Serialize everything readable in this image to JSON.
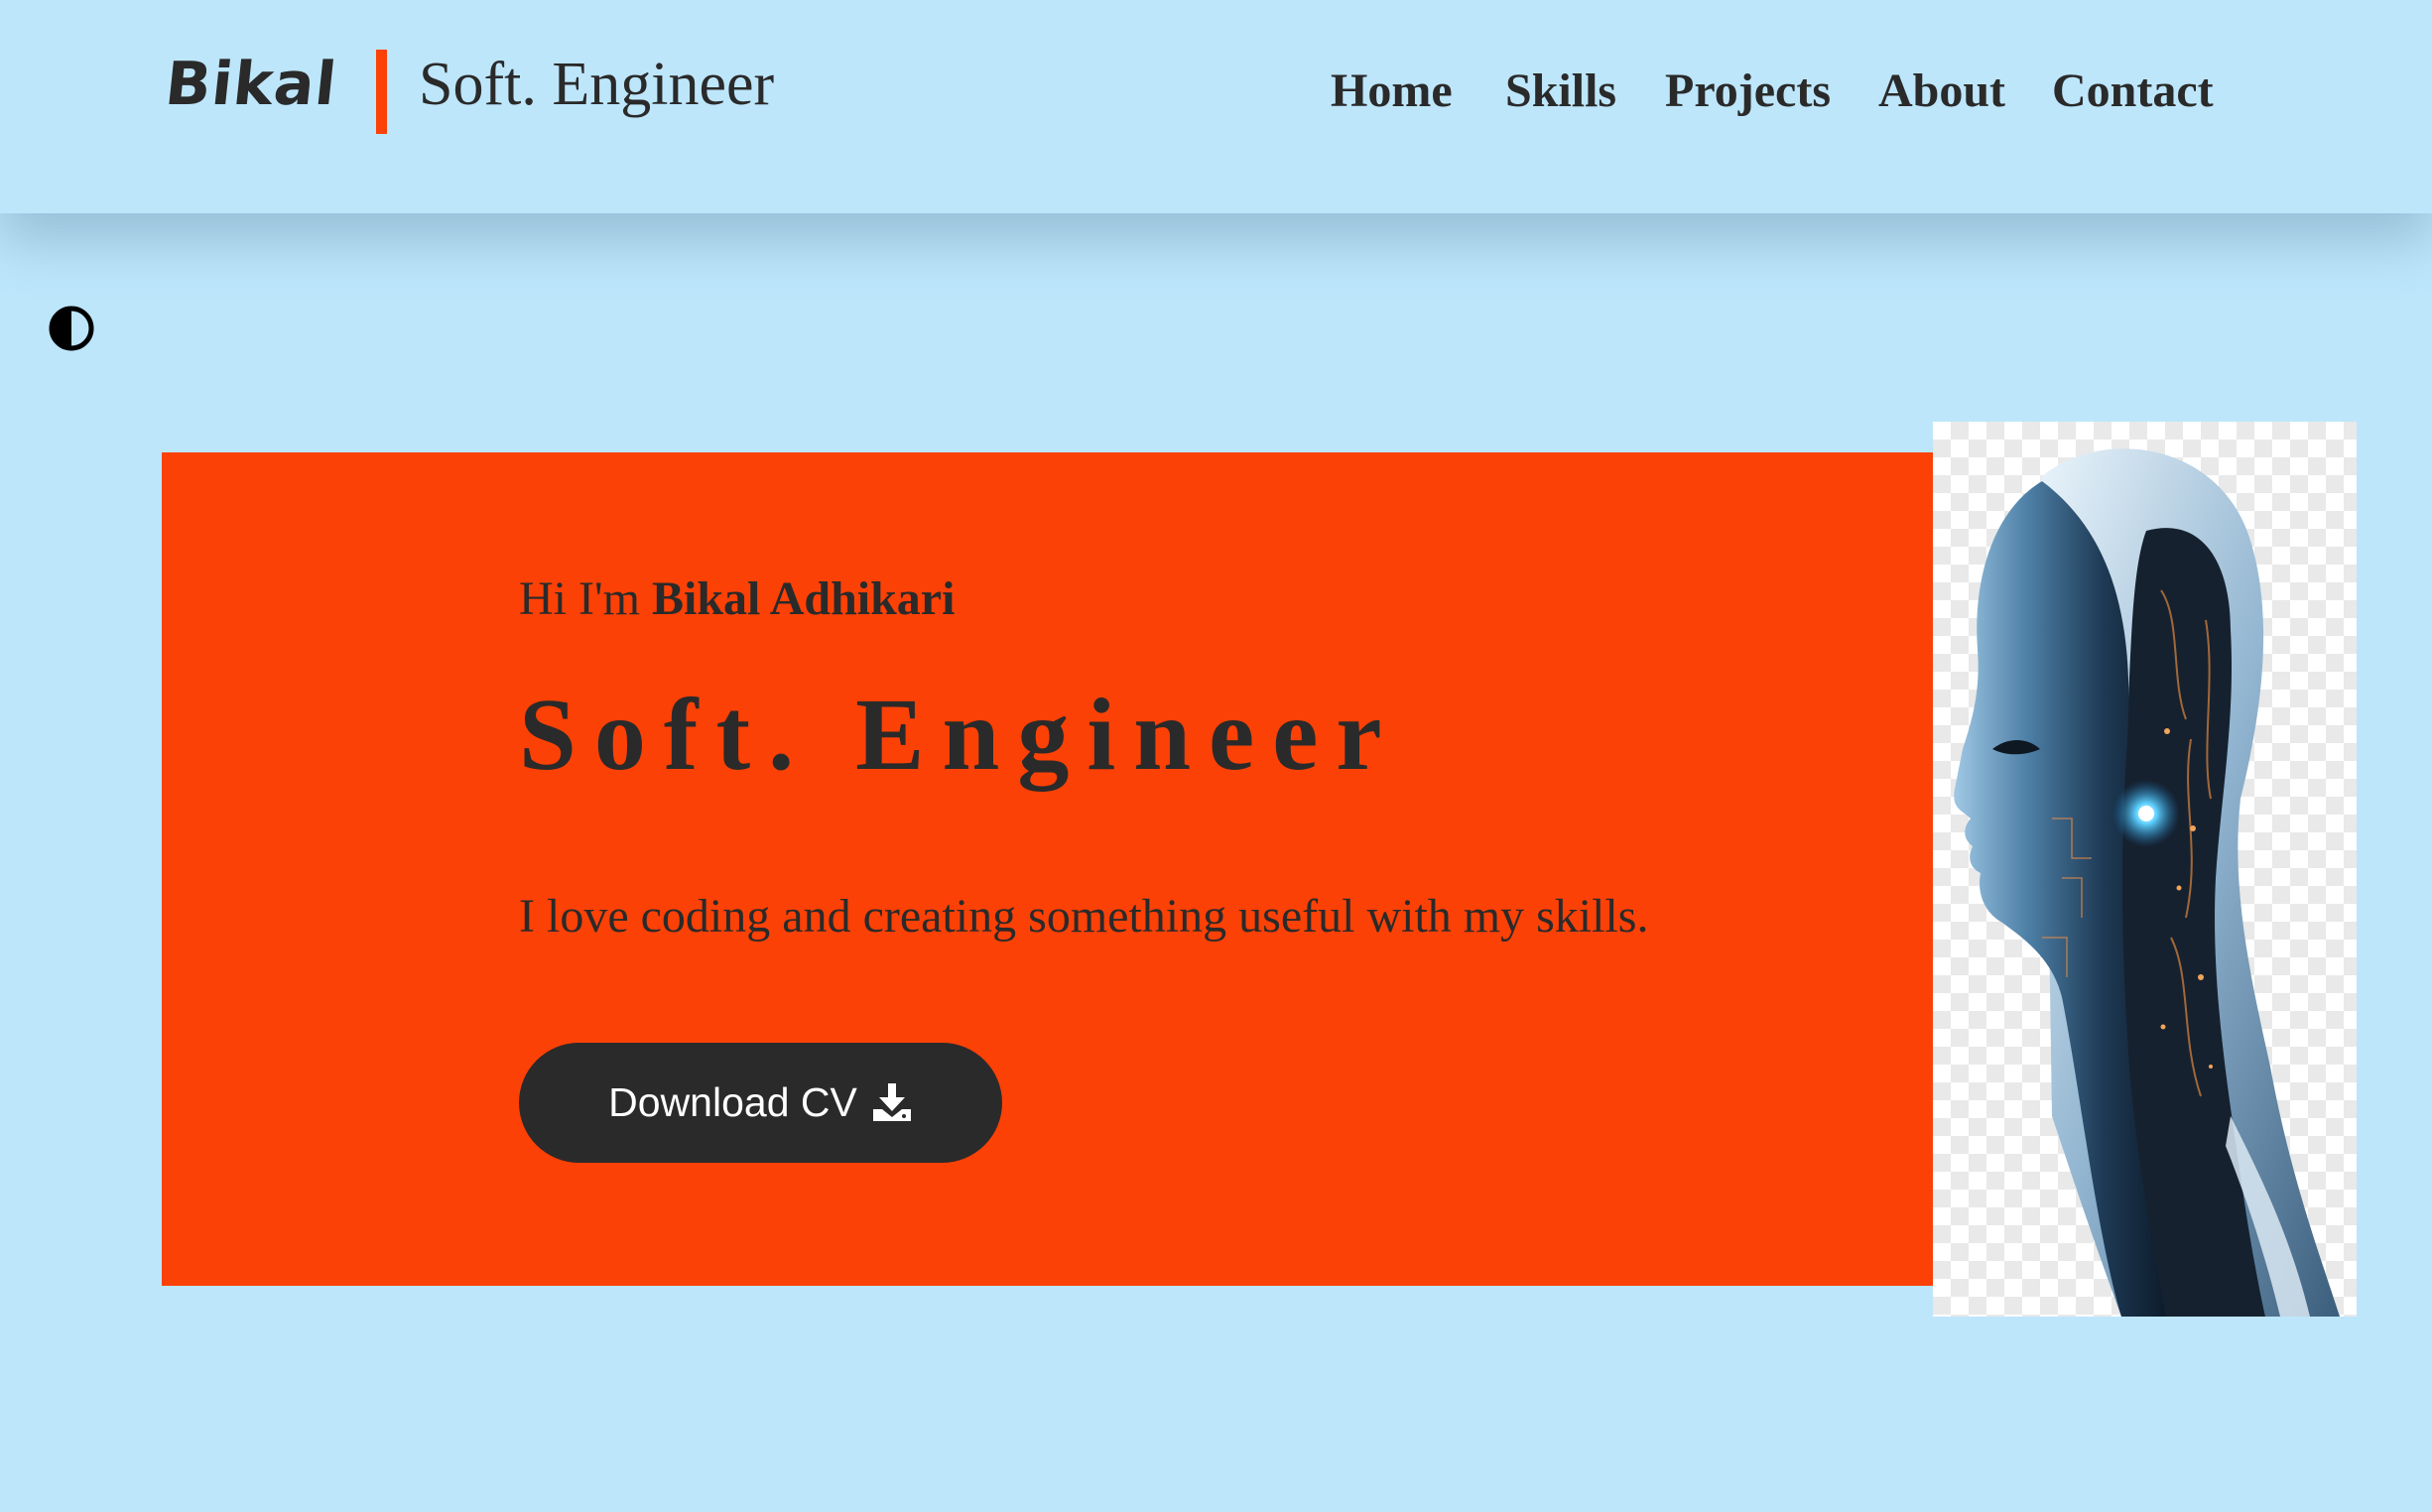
{
  "header": {
    "logo": "Bikal",
    "subtitle": "Soft. Engineer",
    "nav": [
      {
        "label": "Home"
      },
      {
        "label": "Skills"
      },
      {
        "label": "Projects"
      },
      {
        "label": "About"
      },
      {
        "label": "Contact"
      }
    ]
  },
  "theme_toggle": {
    "icon": "contrast-icon"
  },
  "hero": {
    "greeting_prefix": "Hi I'm ",
    "name": "Bikal Adhikari",
    "title": "Soft. Engineer",
    "tagline": "I love coding and creating something useful with my skills.",
    "cv_button": {
      "label": "Download CV",
      "icon": "download-icon"
    }
  },
  "colors": {
    "background": "#bde6fb",
    "accent": "#fb4106",
    "dark": "#2a2a2a",
    "button_text": "#ffffff"
  }
}
